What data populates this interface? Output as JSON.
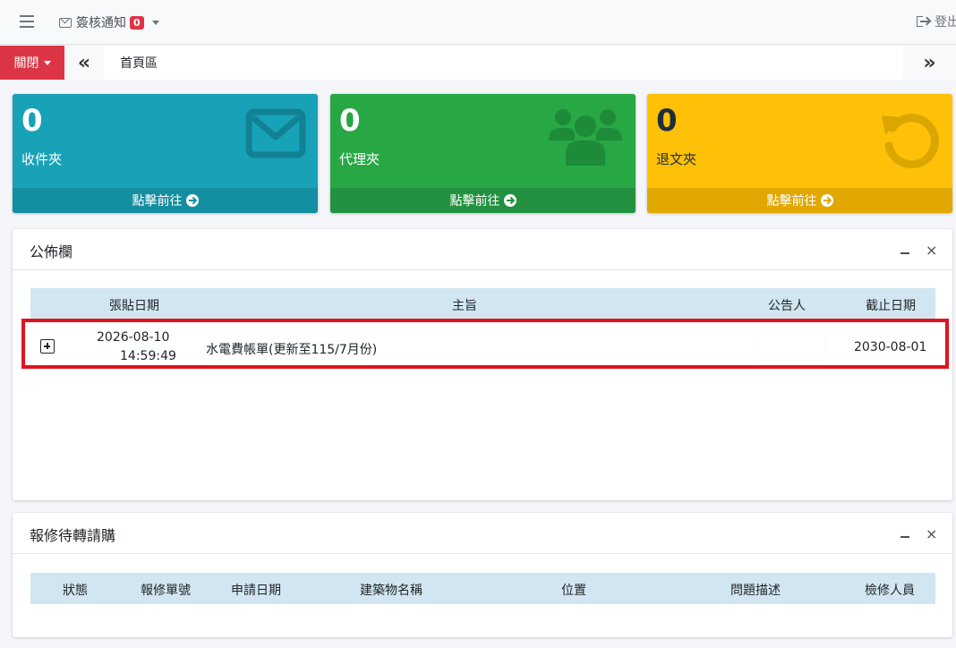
{
  "topbar": {
    "notify_label": "簽核通知",
    "notify_count": "0",
    "logout_label": "登出"
  },
  "tabbar": {
    "close_label": "關閉",
    "prev_glyph": "«",
    "next_glyph": "»",
    "home_tab": "首頁區"
  },
  "boxes": [
    {
      "count": "0",
      "label": "收件夾",
      "link": "點擊前往",
      "icon": "envelope-icon",
      "color": "#17a2b8"
    },
    {
      "count": "0",
      "label": "代理夾",
      "link": "點擊前往",
      "icon": "users-icon",
      "color": "#28a745"
    },
    {
      "count": "0",
      "label": "退文夾",
      "link": "點擊前往",
      "icon": "undo-icon",
      "color": "#ffc107"
    }
  ],
  "bulletin": {
    "title": "公佈欄",
    "columns": [
      "張貼日期",
      "主旨",
      "公告人",
      "截止日期"
    ],
    "rows": [
      {
        "post_date": "2026-08-10",
        "post_time": "14:59:49",
        "subject": "水電費帳單(更新至115/7月份)",
        "poster": "",
        "due_date": "2030-08-01"
      }
    ]
  },
  "repair": {
    "title": "報修待轉請購",
    "columns": [
      "狀態",
      "報修單號",
      "申請日期",
      "建築物名稱",
      "位置",
      "問題描述",
      "檢修人員"
    ]
  },
  "card_tools": {
    "minimize": "–",
    "close": "×"
  }
}
